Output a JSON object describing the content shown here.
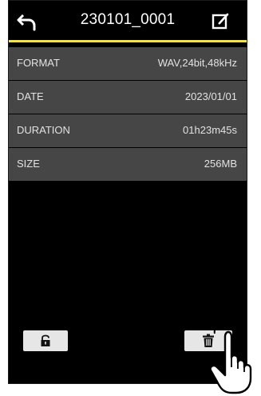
{
  "header": {
    "title": "230101_0001",
    "icons": {
      "back": "back-arrow-icon",
      "edit": "edit-icon"
    },
    "accent_color": "#efe25a"
  },
  "info_rows": [
    {
      "label": "FORMAT",
      "value": "WAV,24bit,48kHz"
    },
    {
      "label": "DATE",
      "value": "2023/01/01"
    },
    {
      "label": "DURATION",
      "value": "01h23m45s"
    },
    {
      "label": "SIZE",
      "value": "256MB"
    }
  ],
  "buttons": {
    "lock": {
      "icon": "unlock-icon"
    },
    "delete": {
      "icon": "trash-icon"
    }
  },
  "colors": {
    "background": "#000000",
    "row_background": "#464646",
    "text": "#e2e2e2"
  }
}
